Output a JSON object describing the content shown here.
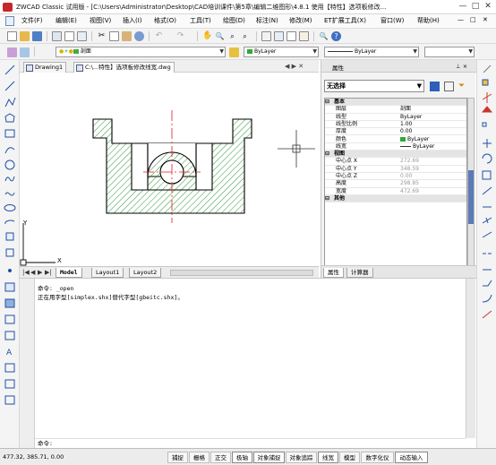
{
  "window": {
    "title": "ZWCAD Classic 试用版 - [C:\\Users\\Administrator\\Desktop\\CAD培训课件\\第5章\\编辑二维图形\\4.8.1 使用【特性】选项板修改...",
    "min": "—",
    "max": "□",
    "close": "✕"
  },
  "menu": {
    "items": [
      "文件(F)",
      "编辑(E)",
      "视图(V)",
      "插入(I)",
      "格式(O)",
      "工具(T)",
      "绘图(D)",
      "标注(N)",
      "修改(M)",
      "ET扩展工具(X)",
      "窗口(W)",
      "帮助(H)"
    ],
    "doc_min": "—",
    "doc_max": "□",
    "doc_close": "✕"
  },
  "toolbar2": {
    "layer_value": "剖面",
    "color_value": "ByLayer",
    "linetype_value": "ByLayer"
  },
  "doc_tabs": [
    {
      "label": "Drawing1"
    },
    {
      "label": "C:\\...特性】选项板修改线宽.dwg"
    }
  ],
  "doc_tab_nav": "◀ ▶ ✕",
  "layout_tabs": {
    "nav": [
      "|◀",
      "◀",
      "▶",
      "▶|"
    ],
    "tabs": [
      "Model",
      "Layout1",
      "Layout2"
    ]
  },
  "properties": {
    "title": "属性",
    "pin": "⊥ ×",
    "selection": "无选择",
    "rows": [
      {
        "k": "基本",
        "v": "",
        "cat": true
      },
      {
        "k": "图层",
        "v": "剖面"
      },
      {
        "k": "线型",
        "v": "ByLayer"
      },
      {
        "k": "线型比例",
        "v": "1.00"
      },
      {
        "k": "厚度",
        "v": "0.00"
      },
      {
        "k": "颜色",
        "v": "ByLayer",
        "swatch": "#2eaa38"
      },
      {
        "k": "线宽",
        "v": "ByLayer",
        "dash": true
      },
      {
        "k": "视图",
        "v": "",
        "cat": true
      },
      {
        "k": "中心点 X",
        "v": "272.69",
        "grey": true
      },
      {
        "k": "中心点 Y",
        "v": "348.59",
        "grey": true
      },
      {
        "k": "中心点 Z",
        "v": "0.00",
        "grey": true
      },
      {
        "k": "高度",
        "v": "298.85",
        "grey": true
      },
      {
        "k": "宽度",
        "v": "472.69",
        "grey": true
      },
      {
        "k": "其他",
        "v": "",
        "cat": true
      }
    ],
    "tabs": [
      "属性",
      "计算器"
    ]
  },
  "command": {
    "lines": [
      "命令: _open",
      "正在用字型[simplex.shx]替代字型[gbeitc.shx]。"
    ],
    "prompt": "命令:"
  },
  "status": {
    "coords": "477.32,  385.71,  0.00",
    "buttons": [
      "捕捉",
      "栅格",
      "正交",
      "极轴",
      "对象捕捉",
      "对象追踪",
      "线宽",
      "模型",
      "数字化仪",
      "动态输入"
    ]
  },
  "canvas": {
    "ucs_y": "Y",
    "ucs_x": "X"
  },
  "colors": {
    "hatch": "#1a8a22",
    "centerline": "#e21b1b",
    "outline": "#000000"
  }
}
